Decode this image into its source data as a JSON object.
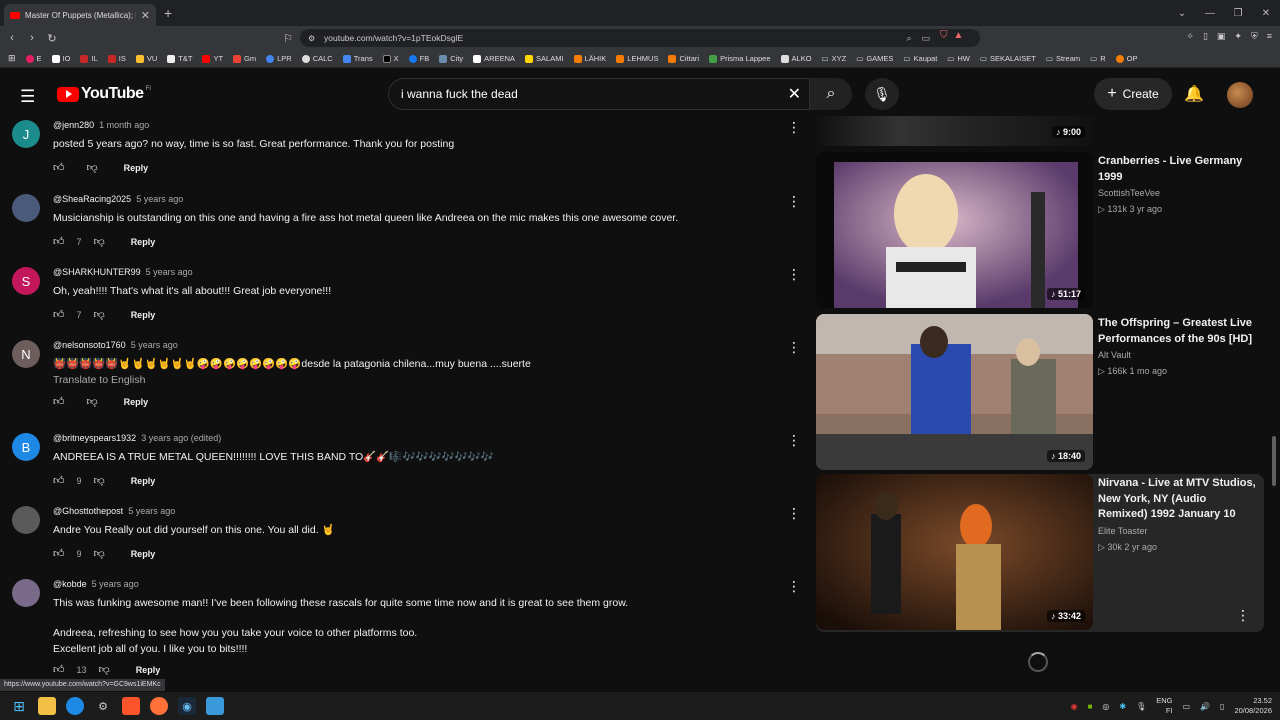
{
  "browser": {
    "tab_title": "Master Of Puppets (Metallica); B",
    "url": "youtube.com/watch?v=1pTEokDsglE",
    "status_url": "https://www.youtube.com/watch?v=GC9ws1iEMKc",
    "bookmarks": [
      "E",
      "IO",
      "IL",
      "IS",
      "VU",
      "T&T",
      "YT",
      "Gm",
      "LPR",
      "CALC",
      "Trans",
      "X",
      "FB",
      "City",
      "AREENA",
      "SALAMI",
      "LÄHIK",
      "LEHMUS",
      "Cittari",
      "Prisma Lappee",
      "ALKO",
      "XYZ",
      "GAMES",
      "Kaupat",
      "HW",
      "SEKALAISET",
      "Stream",
      "R",
      "OP"
    ]
  },
  "header": {
    "logo": "YouTube",
    "logo_country": "FI",
    "search_value": "i wanna fuck the dead",
    "create_label": "Create"
  },
  "comments": [
    {
      "avatar": "J",
      "avatar_color": "#1c8b8b",
      "handle": "@jenn280",
      "time": "1 month ago",
      "text": "posted 5 years ago?  no way,  time is so fast.    Great performance.  Thank you for posting",
      "likes": ""
    },
    {
      "avatar": "",
      "avatar_color": "#4a5a7a",
      "handle": "@SheaRacing2025",
      "time": "5 years ago",
      "text": "Musicianship is outstanding on this one and having a fire ass hot metal queen like Andreea on the mic makes this one awesome cover.",
      "likes": "7"
    },
    {
      "avatar": "S",
      "avatar_color": "#c2185b",
      "handle": "@SHARKHUNTER99",
      "time": "5 years ago",
      "text": "Oh, yeah!!!! That's what it's all about!!! Great job everyone!!!",
      "likes": "7"
    },
    {
      "avatar": "N",
      "avatar_color": "#6d5d5d",
      "handle": "@nelsonsoto1760",
      "time": "5 years ago",
      "text": "👹👹👹👹👹🤘🤘🤘🤘🤘🤘🤪🤪🤪🤪🤪🤪🤪🤪desde la patagonia chilena...muy buena ....suerte",
      "translate": "Translate to English",
      "likes": ""
    },
    {
      "avatar": "B",
      "avatar_color": "#1e88e5",
      "handle": "@britneyspears1932",
      "time": "3 years ago (edited)",
      "text": "ANDREEA IS A TRUE METAL QUEEN!!!!!!!! LOVE THIS BAND TO🎸🎸🎼🎶🎶🎶🎶🎶🎶🎶",
      "likes": "9"
    },
    {
      "avatar": "",
      "avatar_color": "#5a5a5a",
      "handle": "@Ghosttothepost",
      "time": "5 years ago",
      "text": "Andre You Really out did yourself on this one. You all did. 🤘",
      "likes": "9"
    },
    {
      "avatar": "",
      "avatar_color": "#7a6a8a",
      "handle": "@kobde",
      "time": "5 years ago",
      "text": "This was funking awesome man!! I've been following these rascals for quite some time now and it is great to see them grow.",
      "text2": "Andreea, refreshing to see how you you take your voice to other platforms too.",
      "text3": "Excellent job all of you. I like you to bits!!!!",
      "likes": "13"
    }
  ],
  "reply_label": "Reply",
  "videos": [
    {
      "duration": "9:00",
      "title": "",
      "channel": "",
      "stats": ""
    },
    {
      "duration": "51:17",
      "title": "Cranberries - Live Germany 1999",
      "channel": "ScottishTeeVee",
      "stats": "131k  3 yr ago"
    },
    {
      "duration": "18:40",
      "title": "The Offspring – Greatest Live Performances of the 90s [HD]",
      "channel": "Alt Vault",
      "stats": "166k  1 mo ago"
    },
    {
      "duration": "33:42",
      "title": "Nirvana - Live at MTV Studios, New York, NY (Audio Remixed) 1992 January 10",
      "channel": "Elite Toaster",
      "stats": "30k  2 yr ago"
    }
  ],
  "taskbar": {
    "lang": "ENG",
    "lang2": "FI",
    "time": "23.52",
    "date": "20/08/2026"
  },
  "colors": {
    "accent": "#ff0000",
    "background": "#0f0f0f"
  }
}
